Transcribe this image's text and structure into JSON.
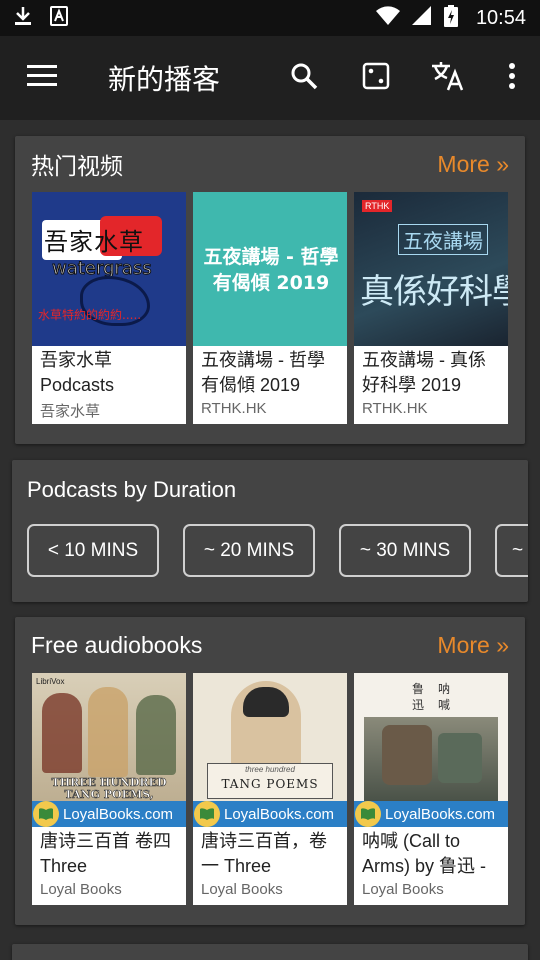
{
  "status_bar": {
    "time": "10:54",
    "icons": [
      "download-icon",
      "translate-a-icon",
      "wifi-icon",
      "signal-icon",
      "battery-charging-icon"
    ]
  },
  "app_bar": {
    "title": "新的播客",
    "icons": [
      "menu-icon",
      "search-icon",
      "dice-icon",
      "translate-icon",
      "overflow-icon"
    ]
  },
  "hot_videos": {
    "title": "热门视频",
    "more": "More »",
    "items": [
      {
        "title": "吾家水草 Podcasts",
        "source": "吾家水草",
        "art_text": "吾家水草",
        "art_sub": "watergrass",
        "art_line": "水草特約的約約....."
      },
      {
        "title": "五夜講場 - 哲學有偈傾 2019",
        "source": "RTHK.HK",
        "art_text": "五夜講場 - 哲學有偈傾 2019"
      },
      {
        "title": "五夜講場 - 真係好科學 2019",
        "source": "RTHK.HK",
        "art_text": "五夜講場",
        "art_sub": "真係好科學",
        "art_logo": "RTHK"
      }
    ]
  },
  "duration": {
    "title": "Podcasts by Duration",
    "chips": [
      "< 10 MINS",
      "~ 20 MINS",
      "~ 30 MINS",
      "~"
    ]
  },
  "audiobooks": {
    "title": "Free audiobooks",
    "more": "More »",
    "badge": "LoyalBooks.com",
    "items": [
      {
        "title": "唐诗三百首 卷四 Three",
        "source": "Loyal Books",
        "art_text": "THREE HUNDRED TANG POEMS,",
        "art_logo": "LibriVox"
      },
      {
        "title": "唐诗三百首，卷一 Three",
        "source": "Loyal Books",
        "art_text": "TANG POEMS",
        "art_sub": "three hundred"
      },
      {
        "title": "呐喊 (Call to Arms) by 鲁迅 -",
        "source": "Loyal Books",
        "art_text": "鲁迅",
        "art_sub": "呐喊"
      }
    ]
  },
  "colors": {
    "accent": "#e8892b",
    "card": "#444444",
    "appbar": "#202020",
    "teal": "#3fb8ae"
  }
}
